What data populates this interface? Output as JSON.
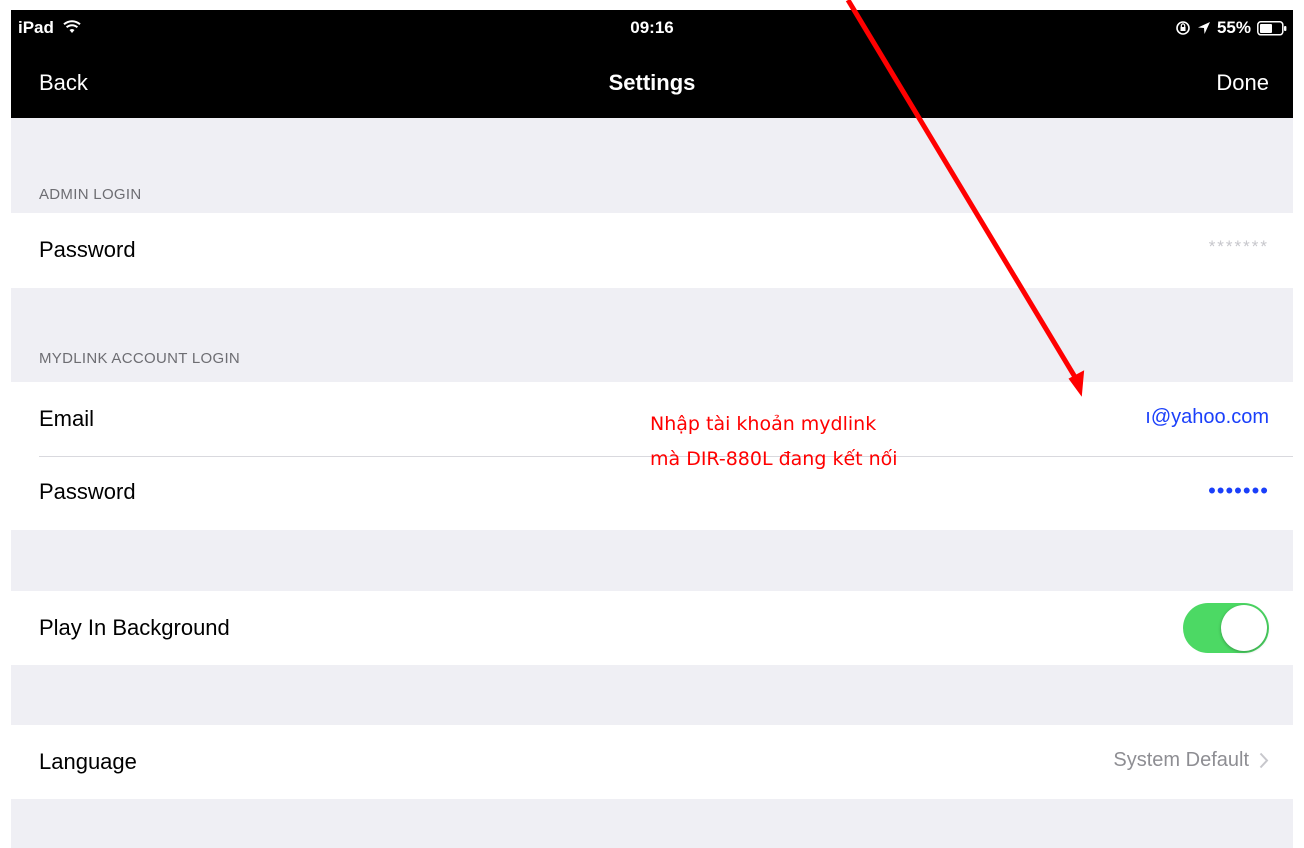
{
  "status_bar": {
    "carrier": "iPad",
    "time": "09:16",
    "battery": "55%"
  },
  "nav": {
    "back": "Back",
    "title": "Settings",
    "done": "Done"
  },
  "admin_section": {
    "header": "ADMIN LOGIN",
    "password_label": "Password",
    "password_value": "*******"
  },
  "mydlink_section": {
    "header": "MYDLINK ACCOUNT LOGIN",
    "email_label": "Email",
    "email_value": "ı@yahoo.com",
    "password_label": "Password",
    "password_value": "•••••••"
  },
  "background": {
    "label": "Play In Background",
    "enabled": true
  },
  "language": {
    "label": "Language",
    "value": "System Default"
  },
  "annotation": {
    "line1": "Nhập tài khoản mydlink",
    "line2": "mà DIR-880L đang kết nối"
  },
  "colors": {
    "toggle_on": "#4cd964",
    "link_blue": "#1a3ffa",
    "annotation_red": "#ff0000"
  }
}
